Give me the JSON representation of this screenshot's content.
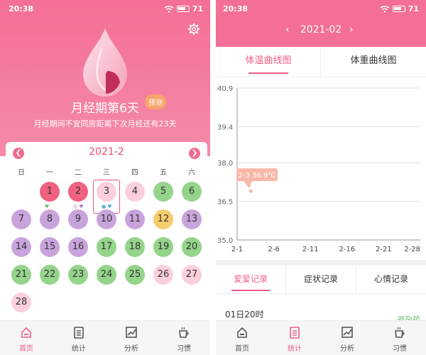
{
  "left": {
    "status": {
      "time": "20:38",
      "battery": "71"
    },
    "hero": {
      "title": "月经期第6天",
      "badge": "预测",
      "subtitle": "月经期间不宜同房距离下次月经还有23天"
    },
    "calendar": {
      "month": "2021-2",
      "weekdays": [
        "日",
        "一",
        "二",
        "三",
        "四",
        "五",
        "六"
      ],
      "days": [
        {
          "day": "1",
          "color": "red",
          "col": 1,
          "row": 0
        },
        {
          "day": "2",
          "color": "red",
          "col": 2,
          "row": 0
        },
        {
          "day": "3",
          "color": "pink",
          "col": 3,
          "row": 0
        },
        {
          "day": "4",
          "color": "pink",
          "col": 4,
          "row": 0
        },
        {
          "day": "5",
          "color": "green",
          "col": 5,
          "row": 0
        },
        {
          "day": "6",
          "color": "green",
          "col": 6,
          "row": 0
        },
        {
          "day": "7",
          "color": "purple",
          "col": 0,
          "row": 1
        },
        {
          "day": "8",
          "color": "purple",
          "col": 1,
          "row": 1
        },
        {
          "day": "9",
          "color": "purple",
          "col": 2,
          "row": 1
        },
        {
          "day": "10",
          "color": "purple",
          "col": 3,
          "row": 1
        },
        {
          "day": "11",
          "color": "purple",
          "col": 4,
          "row": 1
        },
        {
          "day": "12",
          "color": "yellow",
          "col": 5,
          "row": 1
        },
        {
          "day": "13",
          "color": "purple",
          "col": 6,
          "row": 1
        },
        {
          "day": "14",
          "color": "purple",
          "col": 0,
          "row": 2
        },
        {
          "day": "15",
          "color": "purple",
          "col": 1,
          "row": 2
        },
        {
          "day": "16",
          "color": "purple",
          "col": 2,
          "row": 2
        },
        {
          "day": "17",
          "color": "green",
          "col": 3,
          "row": 2
        },
        {
          "day": "18",
          "color": "green",
          "col": 4,
          "row": 2
        },
        {
          "day": "19",
          "color": "green",
          "col": 5,
          "row": 2
        },
        {
          "day": "20",
          "color": "green",
          "col": 6,
          "row": 2
        },
        {
          "day": "21",
          "color": "green",
          "col": 0,
          "row": 3
        },
        {
          "day": "22",
          "color": "green",
          "col": 1,
          "row": 3
        },
        {
          "day": "23",
          "color": "green",
          "col": 2,
          "row": 3
        },
        {
          "day": "24",
          "color": "green",
          "col": 3,
          "row": 3
        },
        {
          "day": "25",
          "color": "green",
          "col": 4,
          "row": 3
        },
        {
          "day": "26",
          "color": "pink",
          "col": 5,
          "row": 3
        },
        {
          "day": "27",
          "color": "pink",
          "col": 6,
          "row": 3
        },
        {
          "day": "28",
          "color": "pink",
          "col": 0,
          "row": 4
        }
      ],
      "selected_day": "3"
    },
    "nav": [
      {
        "label": "首页",
        "icon": "home-icon",
        "active": true
      },
      {
        "label": "统计",
        "icon": "clipboard-icon",
        "active": false
      },
      {
        "label": "分析",
        "icon": "trend-chart-icon",
        "active": false
      },
      {
        "label": "习惯",
        "icon": "cup-icon",
        "active": false
      }
    ]
  },
  "right": {
    "status": {
      "time": "20:38",
      "battery": "71"
    },
    "month": "2021-02",
    "tabs": [
      "体温曲线图",
      "体重曲线图"
    ],
    "record_tabs": [
      "爱爱记录",
      "症状记录",
      "心情记录"
    ],
    "record": {
      "time": "01日20时",
      "tag": "避孕药"
    },
    "nav": [
      {
        "label": "首页",
        "icon": "home-icon",
        "active": false
      },
      {
        "label": "统计",
        "icon": "clipboard-icon",
        "active": true
      },
      {
        "label": "分析",
        "icon": "trend-chart-icon",
        "active": false
      },
      {
        "label": "习惯",
        "icon": "cup-icon",
        "active": false
      }
    ]
  },
  "chart_data": {
    "type": "line",
    "categories": [
      "2-1",
      "2-6",
      "2-11",
      "2-16",
      "2-21",
      "2-28"
    ],
    "y_ticks": [
      "35.0",
      "36.5",
      "38.0",
      "39.4",
      "40.9"
    ],
    "ylim": [
      35.0,
      40.9
    ],
    "points": [
      {
        "x": "2-3",
        "y": 36.9
      }
    ],
    "tooltip": "2-3  36.9℃",
    "grid": true
  },
  "colors": {
    "accent": "#ef5f86",
    "header": "#f46f95"
  }
}
